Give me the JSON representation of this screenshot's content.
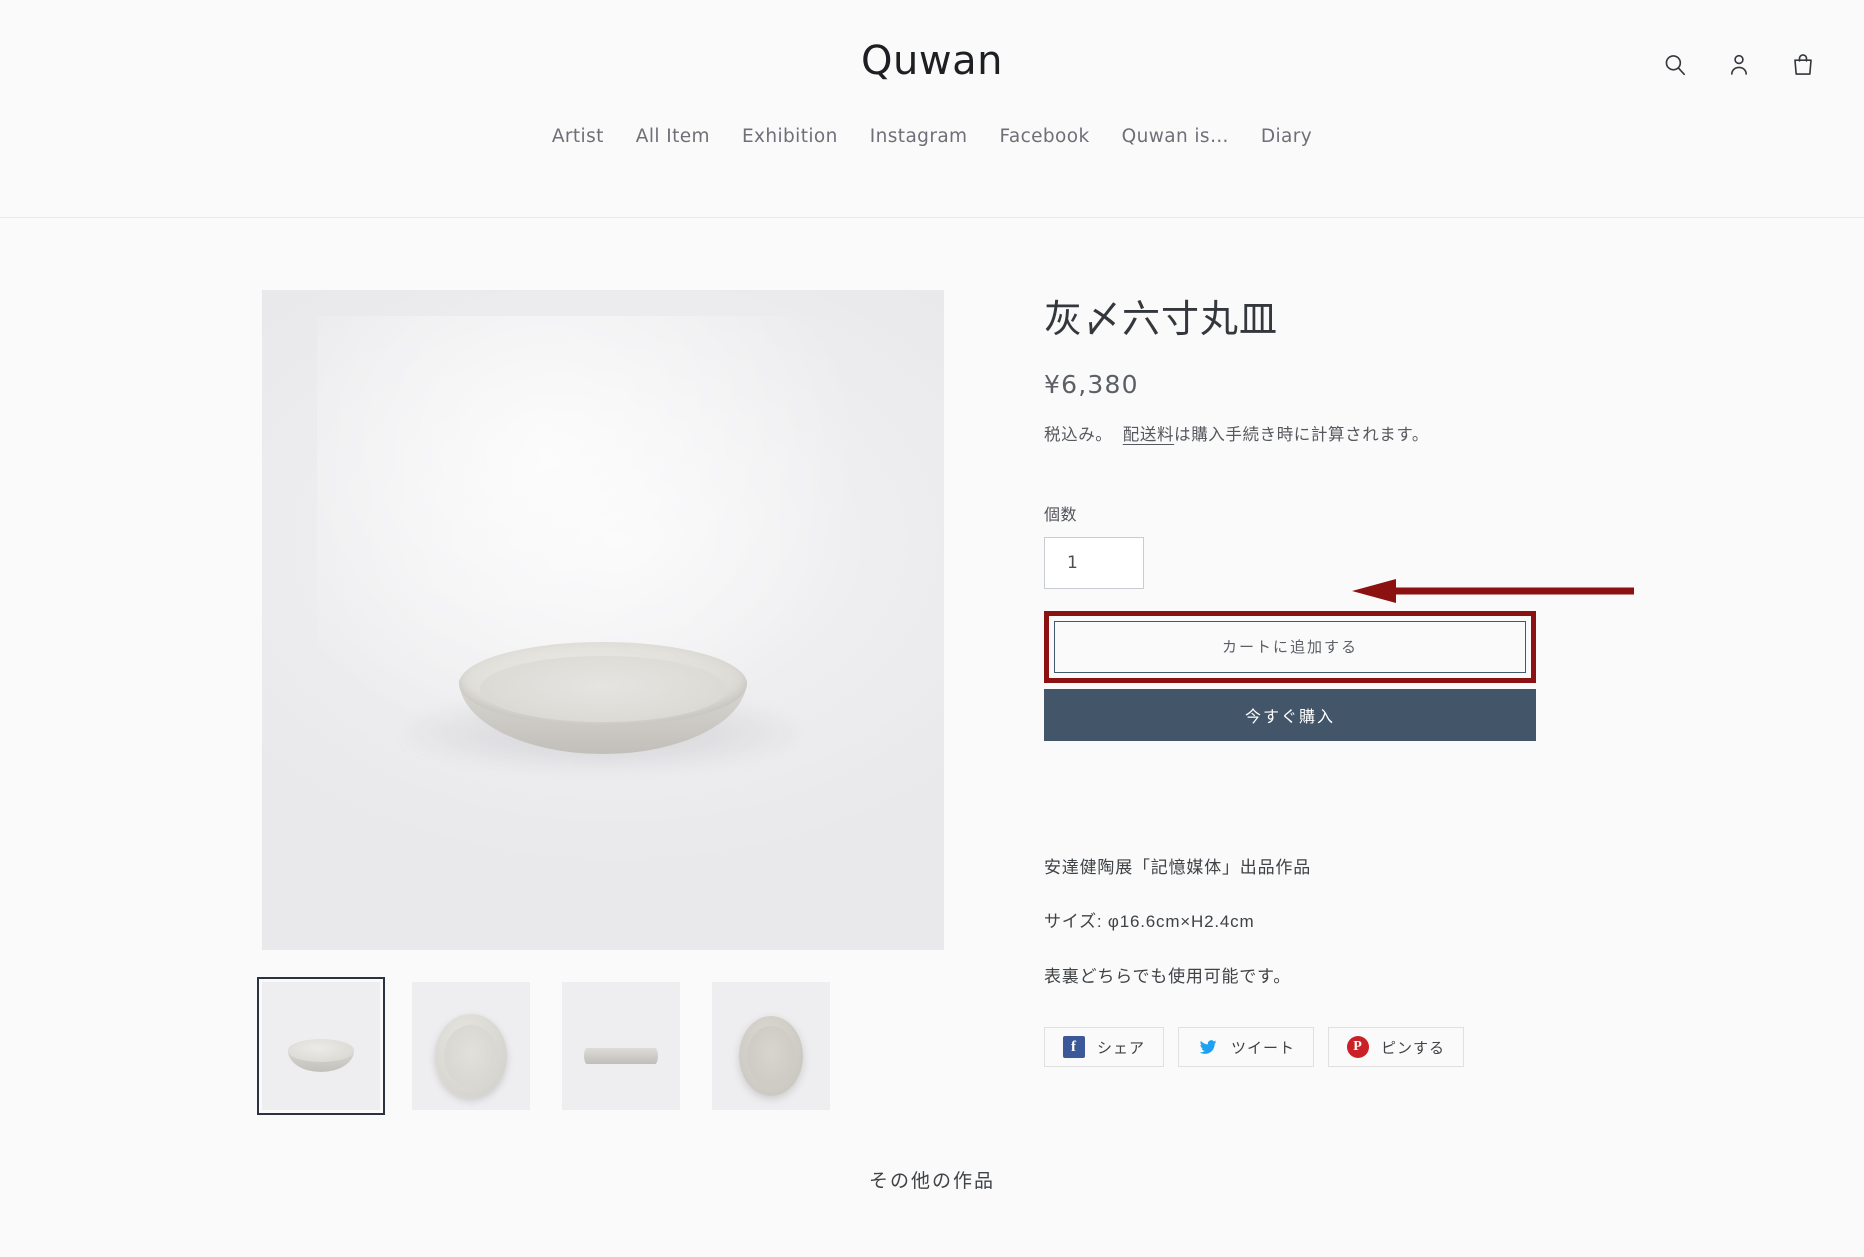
{
  "header": {
    "logo": "Quwan",
    "icons": [
      {
        "name": "search-icon",
        "label": "Search"
      },
      {
        "name": "account-icon",
        "label": "Account"
      },
      {
        "name": "cart-icon",
        "label": "Cart"
      }
    ],
    "nav": [
      {
        "label": "Artist"
      },
      {
        "label": "All Item"
      },
      {
        "label": "Exhibition"
      },
      {
        "label": "Instagram"
      },
      {
        "label": "Facebook"
      },
      {
        "label": "Quwan is…"
      },
      {
        "label": "Diary"
      }
    ]
  },
  "product": {
    "title": "灰〆六寸丸皿",
    "price": "¥6,380",
    "tax_text": "税込み。",
    "shipping_link": "配送料",
    "shipping_rest": "は購入手続き時に計算されます。",
    "quantity_label": "個数",
    "quantity_value": "1",
    "add_to_cart_label": "カートに追加する",
    "buy_now_label": "今すぐ購入",
    "description": [
      "安達健陶展「記憶媒体」出品作品",
      "サイズ: φ16.6cm×H2.4cm",
      "表裏どちらでも使用可能です。"
    ],
    "thumbnails": [
      {
        "alt": "plate angled view",
        "selected": true
      },
      {
        "alt": "plate top view",
        "selected": false
      },
      {
        "alt": "plate side profile view",
        "selected": false
      },
      {
        "alt": "plate underside view",
        "selected": false
      }
    ]
  },
  "share": {
    "buttons": [
      {
        "network": "facebook",
        "glyph": "f",
        "label": "シェア"
      },
      {
        "network": "twitter",
        "glyph": "",
        "label": "ツイート"
      },
      {
        "network": "pinterest",
        "glyph": "P",
        "label": "ピンする"
      }
    ]
  },
  "related": {
    "heading": "その他の作品"
  },
  "annotation": {
    "color": "#8c1111",
    "target": "add-to-cart-button",
    "arrow_direction": "left"
  },
  "colors": {
    "page_bg": "#fafafa",
    "buy_button_bg": "#425569",
    "annotation_red": "#8c1111",
    "nav_text": "#6f6f78"
  }
}
